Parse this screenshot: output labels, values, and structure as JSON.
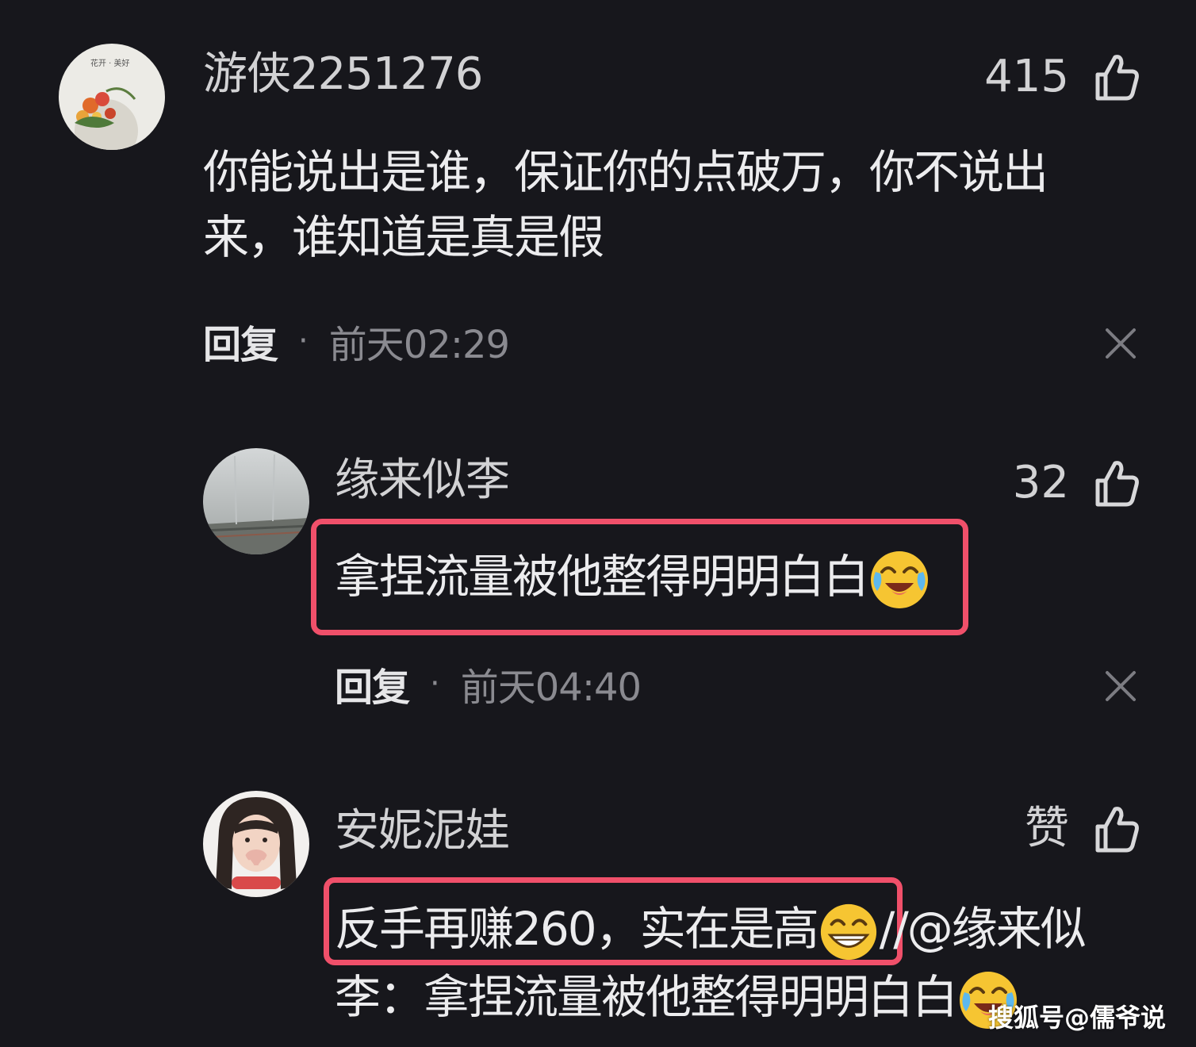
{
  "comments": [
    {
      "username": "游侠2251276",
      "likes": "415",
      "text_lines": [
        "你能说出是谁，保证你的点破万，你不说出",
        "来，谁知道是真是假"
      ],
      "reply_label": "回复",
      "separator": "·",
      "time": "前天02:29"
    },
    {
      "username": "缘来似李",
      "likes": "32",
      "text": "拿捏流量被他整得明明白白",
      "reply_label": "回复",
      "separator": "·",
      "time": "前天04:40"
    },
    {
      "username": "安妮泥娃",
      "likes": "赞",
      "text_highlight": "反手再赚260，实在是高",
      "text_rest": "//@缘来似",
      "text_line2": "李：拿捏流量被他整得明明白白"
    }
  ],
  "watermark": "搜狐号@儒爷说",
  "colors": {
    "background": "#17171c",
    "highlight_border": "#f0506a",
    "muted_text": "#8a8a90"
  },
  "icons": [
    "thumb-up-icon",
    "close-icon",
    "crying-laughing-emoji",
    "grinning-emoji"
  ]
}
